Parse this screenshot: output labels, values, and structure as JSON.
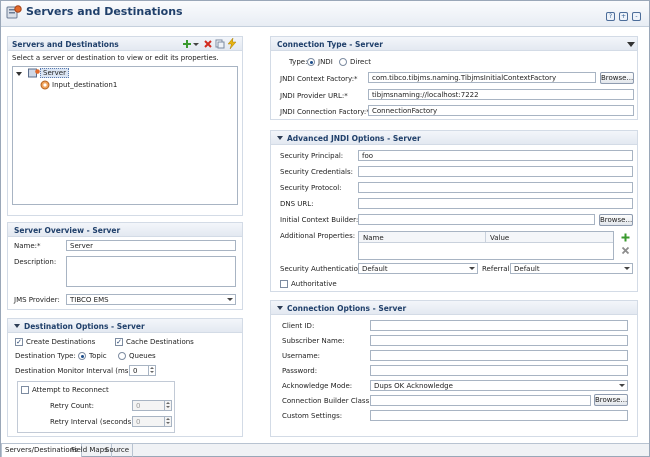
{
  "page": {
    "title": "Servers and Destinations"
  },
  "left": {
    "servers": {
      "title": "Servers and Destinations",
      "hint": "Select a server or destination to view or edit its properties.",
      "tree_root": "Server",
      "tree_child": "Input_destination1"
    },
    "overview": {
      "title": "Server Overview - Server",
      "name_label": "Name:*",
      "name_value": "Server",
      "description_label": "Description:",
      "description_value": "",
      "jms_provider_label": "JMS Provider:",
      "jms_provider_value": "TIBCO EMS"
    },
    "destination": {
      "title": "Destination Options - Server",
      "create_destinations": "Create Destinations",
      "cache_destinations": "Cache Destinations",
      "destination_type_label": "Destination Type:",
      "topic": "Topic",
      "queues": "Queues",
      "monitor_interval_label": "Destination Monitor Interval (ms):",
      "monitor_interval_value": "0",
      "attempt_reconnect": "Attempt to Reconnect",
      "retry_count_label": "Retry Count:",
      "retry_count_value": "0",
      "retry_interval_label": "Retry Interval (seconds):",
      "retry_interval_value": "0"
    }
  },
  "right": {
    "connection_type": {
      "title": "Connection Type - Server",
      "type_label": "Type:",
      "jndi": "JNDI",
      "direct": "Direct",
      "context_factory_label": "JNDI Context Factory:*",
      "context_factory_value": "com.tibco.tibjms.naming.TibjmsInitialContextFactory",
      "provider_url_label": "JNDI Provider URL:*",
      "provider_url_value": "tibjmsnaming://localhost:7222",
      "connection_factory_label": "JNDI Connection Factory:*",
      "connection_factory_value": "ConnectionFactory",
      "browse": "Browse..."
    },
    "advanced": {
      "title": "Advanced JNDI Options - Server",
      "security_principal_label": "Security Principal:",
      "security_principal_value": "foo",
      "security_credentials_label": "Security Credentials:",
      "security_protocol_label": "Security Protocol:",
      "dns_url_label": "DNS URL:",
      "initial_context_builder_label": "Initial Context Builder:",
      "browse": "Browse...",
      "additional_properties_label": "Additional Properties:",
      "col_name": "Name",
      "col_value": "Value",
      "security_auth_label": "Security Authentication:",
      "security_auth_value": "Default",
      "referral_label": "Referral:",
      "referral_value": "Default",
      "authoritative": "Authoritative"
    },
    "connection_options": {
      "title": "Connection Options - Server",
      "client_id_label": "Client ID:",
      "subscriber_name_label": "Subscriber Name:",
      "username_label": "Username:",
      "password_label": "Password:",
      "ack_mode_label": "Acknowledge Mode:",
      "ack_mode_value": "Dups OK Acknowledge",
      "builder_class_label": "Connection Builder Class:",
      "browse": "Browse...",
      "custom_settings_label": "Custom Settings:"
    }
  },
  "tabs": [
    "Servers/Destinations",
    "Field Maps",
    "Source"
  ],
  "colors": {
    "section_title": "#1f3f6a",
    "add_icon": "#3a9a2e",
    "delete_icon": "#d22a1e",
    "lightning_icon": "#e8b410"
  },
  "icons": {
    "add": "add-icon",
    "delete": "delete-icon",
    "copy": "copy-icon",
    "lightning": "lightning-icon",
    "help": "help-icon",
    "server": "server-icon",
    "destination": "destination-icon"
  }
}
